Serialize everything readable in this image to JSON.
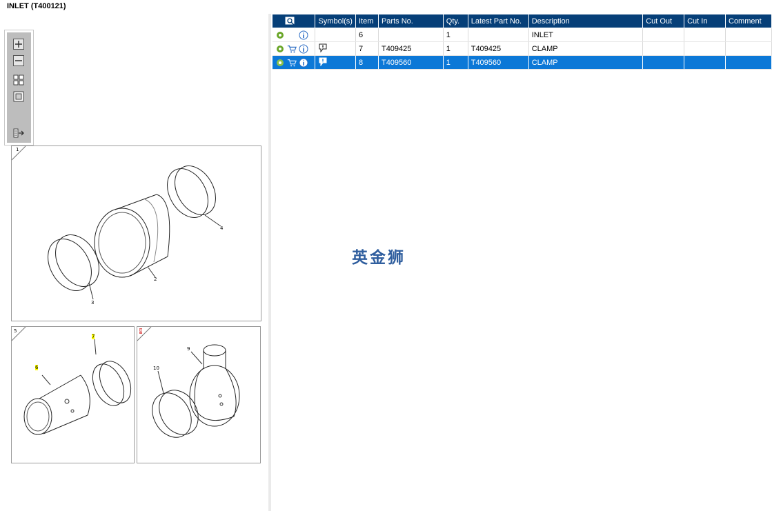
{
  "window": {
    "title": "INLET (T400121)"
  },
  "toolbar": {
    "buttons": [
      {
        "name": "zoom-in",
        "icon": "zoom-in-icon"
      },
      {
        "name": "zoom-out",
        "icon": "zoom-out-icon"
      },
      {
        "name": "fit-all",
        "icon": "fit-all-icon"
      },
      {
        "name": "actual-size",
        "icon": "actual-size-icon"
      },
      {
        "name": "export",
        "icon": "export-icon"
      }
    ]
  },
  "drawing": {
    "panel1": {
      "callouts": [
        "1",
        "2",
        "3",
        "4"
      ]
    },
    "panel2": {
      "callouts": [
        "5",
        "6",
        "7"
      ],
      "highlighted": [
        "6",
        "7"
      ]
    },
    "panel3": {
      "callouts": [
        "8",
        "9",
        "10"
      ],
      "highlighted": [
        "8"
      ]
    },
    "highlight_color": "#ffff00",
    "marker_color": "#e06060"
  },
  "table": {
    "columns": [
      "",
      "Symbol(s)",
      "Item",
      "Parts No.",
      "Qty.",
      "Latest Part No.",
      "Description",
      "Cut Out",
      "Cut In",
      "Comment"
    ],
    "rows": [
      {
        "item": "6",
        "parts_no": "",
        "qty": "1",
        "latest": "",
        "description": "INLET",
        "cut_out": "",
        "cut_in": "",
        "comment": "",
        "cart": false,
        "symbol": false
      },
      {
        "item": "7",
        "parts_no": "T409425",
        "qty": "1",
        "latest": "T409425",
        "description": "CLAMP",
        "cut_out": "",
        "cut_in": "",
        "comment": "",
        "cart": true,
        "symbol": true
      },
      {
        "item": "8",
        "parts_no": "T409560",
        "qty": "1",
        "latest": "T409560",
        "description": "CLAMP",
        "cut_out": "",
        "cut_in": "",
        "comment": "",
        "cart": true,
        "symbol": true,
        "selected": true
      }
    ],
    "header_color": "#063f78",
    "selected_color": "#0c78d7"
  },
  "watermark": "英金狮"
}
